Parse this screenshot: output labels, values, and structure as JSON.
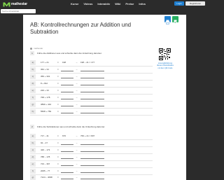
{
  "brand": {
    "name": "mathestar",
    "accent": "#1f7fd0",
    "solution_color": "#27ae60",
    "logo_color": "#7fd44b"
  },
  "nav": {
    "items": [
      "Kurse",
      "Videos",
      "Interaktiv",
      "Wiki",
      "Preise",
      "Infos"
    ],
    "login_label": "Login",
    "register_label": "Registrieren"
  },
  "search": {
    "placeholder": "Suche Arbeitsblatt"
  },
  "worksheet": {
    "title": "AB: Kontrollrechnungen zur Addition und Subtraktion",
    "author": "mathestar",
    "print_icon": "print-icon",
    "solution_icon": "solution-icon",
    "qr_caption": "Lösung/Erklärung dieses Arbeitsblattes mit dem QR-Code",
    "tasks": [
      {
        "number": "1",
        "instruction": "Führe die Additionen aus und schreibe dann die Umkehrung darunter.",
        "rows": [
          {
            "letter": "a)",
            "expr": "177 + 21",
            "eq": "=",
            "answer": "198",
            "arrow": "→",
            "check": "198 – 21 = 177"
          },
          {
            "letter": "b)",
            "expr": "362 + 34",
            "eq": "=",
            "answer": "",
            "arrow": "→",
            "check": ""
          },
          {
            "letter": "c)",
            "expr": "356 + 301",
            "eq": "=",
            "answer": "",
            "arrow": "→",
            "check": ""
          },
          {
            "letter": "d)",
            "expr": "8 + 812",
            "eq": "=",
            "answer": "",
            "arrow": "→",
            "check": ""
          },
          {
            "letter": "e)",
            "expr": "226 + 33",
            "eq": "=",
            "answer": "",
            "arrow": "→",
            "check": ""
          },
          {
            "letter": "f)",
            "expr": "768 + 178",
            "eq": "=",
            "answer": "",
            "arrow": "→",
            "check": ""
          },
          {
            "letter": "g)",
            "expr": "3899 + 444",
            "eq": "=",
            "answer": "",
            "arrow": "→",
            "check": ""
          },
          {
            "letter": "h)",
            "expr": "5508 + 769",
            "eq": "=",
            "answer": "",
            "arrow": "→",
            "check": ""
          }
        ]
      },
      {
        "number": "2",
        "instruction": "Führe die Subtraktionen aus und schreibe dann die Umkehrung darunter.",
        "rows": [
          {
            "letter": "a)",
            "expr": "717 – 41",
            "eq": "=",
            "answer": "676",
            "arrow": "→",
            "check": "766 + 41 = 807"
          },
          {
            "letter": "b)",
            "expr": "92 – 27",
            "eq": "=",
            "answer": "",
            "arrow": "→",
            "check": ""
          },
          {
            "letter": "c)",
            "expr": "426 – 173",
            "eq": "=",
            "answer": "",
            "arrow": "→",
            "check": ""
          },
          {
            "letter": "d)",
            "expr": "788 – 178",
            "eq": "=",
            "answer": "",
            "arrow": "→",
            "check": ""
          },
          {
            "letter": "e)",
            "expr": "723 – 367",
            "eq": "=",
            "answer": "",
            "arrow": "→",
            "check": ""
          },
          {
            "letter": "f)",
            "expr": "2065 – 77",
            "eq": "=",
            "answer": "",
            "arrow": "→",
            "check": ""
          },
          {
            "letter": "g)",
            "expr": "7124 – 4098",
            "eq": "=",
            "answer": "",
            "arrow": "→",
            "check": ""
          }
        ]
      }
    ]
  }
}
